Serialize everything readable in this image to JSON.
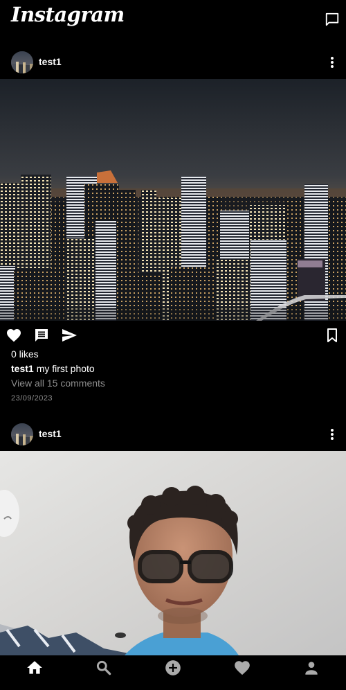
{
  "app": {
    "logo_text": "Instagram",
    "theme": {
      "background": "#000000",
      "text": "#ffffff",
      "muted": "#8e8e8e"
    }
  },
  "header": {
    "dm_icon": "message-square-icon"
  },
  "posts": [
    {
      "username": "test1",
      "image_subject": "night city skyline",
      "likes_text": "0 likes",
      "caption_user": "test1",
      "caption_text": "my first photo",
      "view_comments_text": "View all 15 comments",
      "date": "23/09/2023"
    },
    {
      "username": "test1",
      "image_subject": "selfie of a young man with glasses"
    }
  ],
  "icons": {
    "like": "heart-icon",
    "comment": "comment-icon",
    "share": "send-icon",
    "save": "bookmark-icon",
    "more": "more-vertical-icon"
  },
  "bottom_nav": {
    "items": [
      "home-icon",
      "search-icon",
      "add-post-icon",
      "activity-heart-icon",
      "profile-icon"
    ],
    "active": "home-icon"
  }
}
